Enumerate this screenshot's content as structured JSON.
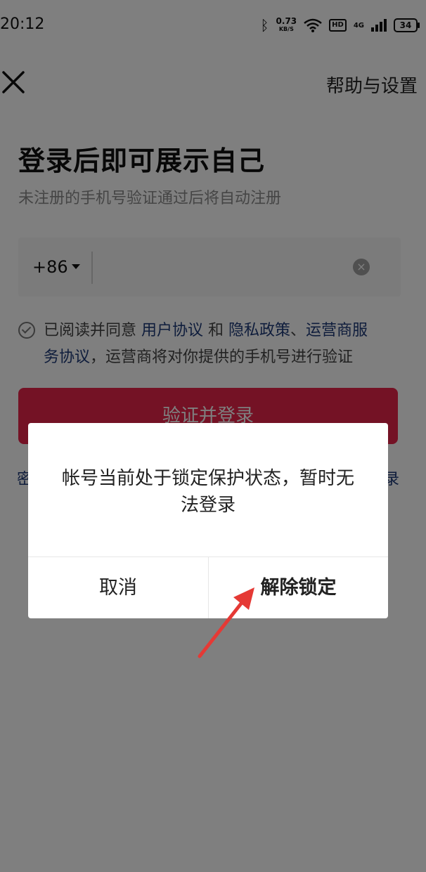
{
  "status_bar": {
    "time": "20:12",
    "net_speed_value": "0.73",
    "net_speed_unit": "KB/S",
    "hd_label": "HD",
    "network_label": "4G",
    "battery": "34"
  },
  "header": {
    "help_label": "帮助与设置"
  },
  "login": {
    "title": "登录后即可展示自己",
    "subtitle": "未注册的手机号验证通过后将自动注册",
    "country_code": "+86",
    "phone_value": "",
    "clear_symbol": "×",
    "agree_text_1": "已阅读并同意 ",
    "link_user_agreement": "用户协议",
    "agree_and": " 和 ",
    "link_privacy": "隐私政策",
    "agree_sep": "、",
    "link_carrier_1": "运营商服",
    "link_carrier_2": "务协议",
    "agree_text_2": "，运营商将对你提供的手机号进行验证",
    "login_button": "验证并登录",
    "bottom_left_partial": "密",
    "bottom_right_partial": "录"
  },
  "dialog": {
    "message": "帐号当前处于锁定保护状态，暂时无法登录",
    "cancel_label": "取消",
    "unlock_label": "解除锁定"
  },
  "colors": {
    "primary_red": "#e8254a",
    "link_blue": "#1f3a78",
    "annotation_arrow": "#e53935"
  }
}
